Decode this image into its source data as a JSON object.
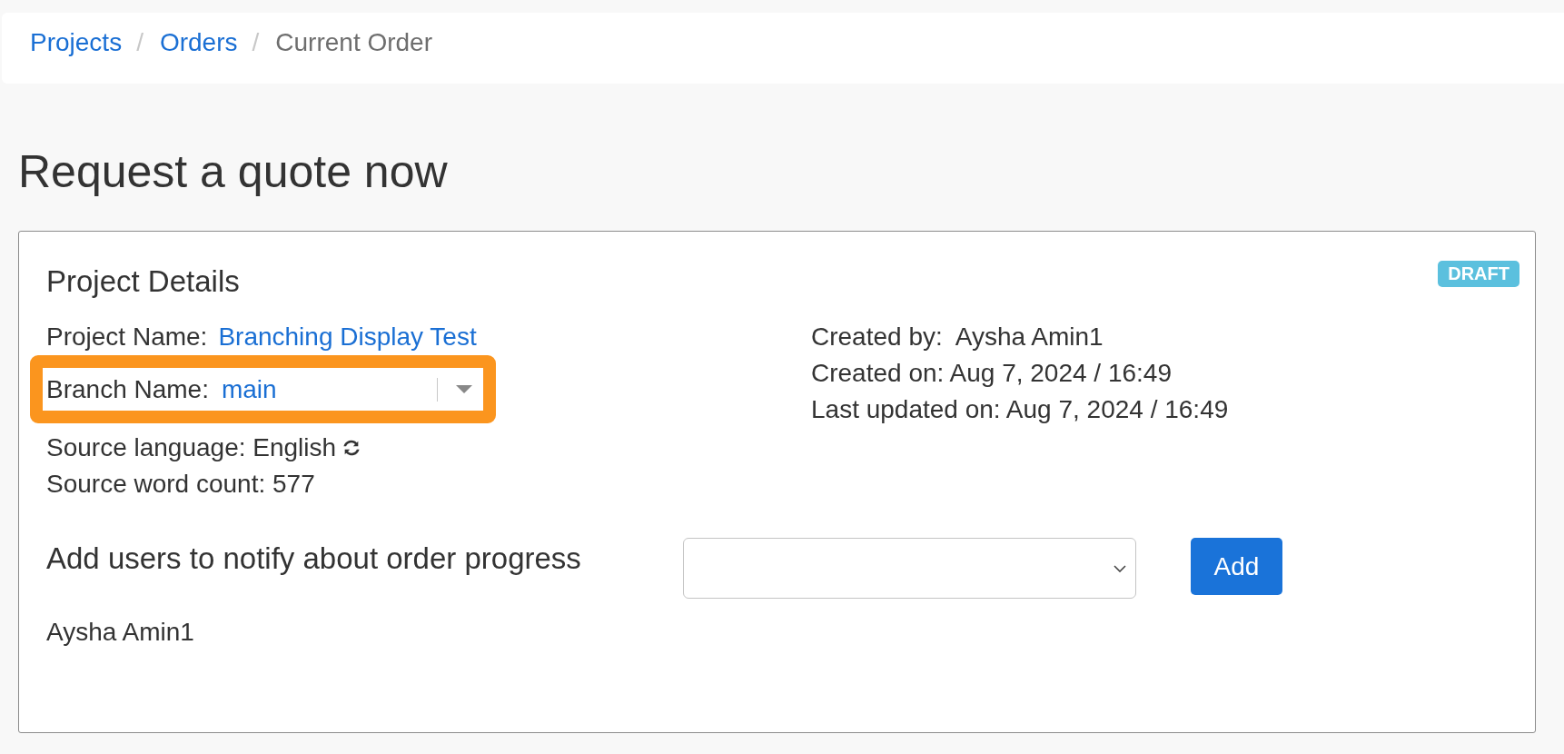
{
  "breadcrumb": [
    {
      "kind": "link",
      "label": "Projects"
    },
    {
      "kind": "separator",
      "label": "/"
    },
    {
      "kind": "link",
      "label": "Orders"
    },
    {
      "kind": "separator",
      "label": "/"
    },
    {
      "kind": "current",
      "label": "Current Order"
    }
  ],
  "heading": "Request a quote now",
  "project_details": {
    "title": "Project Details",
    "status_badge": "DRAFT",
    "project_name": {
      "label": "Project Name:",
      "value": "Branching Display Test"
    },
    "branch_name": {
      "label": "Branch Name:",
      "value": "main",
      "highlighted": true
    },
    "source_language": "Source language: English",
    "source_word_count": "Source word count: 577",
    "meta": [
      "Created by:  Aysha Amin1",
      "Created on: Aug 7, 2024 / 16:49",
      "Last updated on: Aug 7, 2024 / 16:49"
    ]
  },
  "notify": {
    "label": "Add users to notify about order progress",
    "button": "Add",
    "users": [
      "Aysha Amin1"
    ]
  }
}
